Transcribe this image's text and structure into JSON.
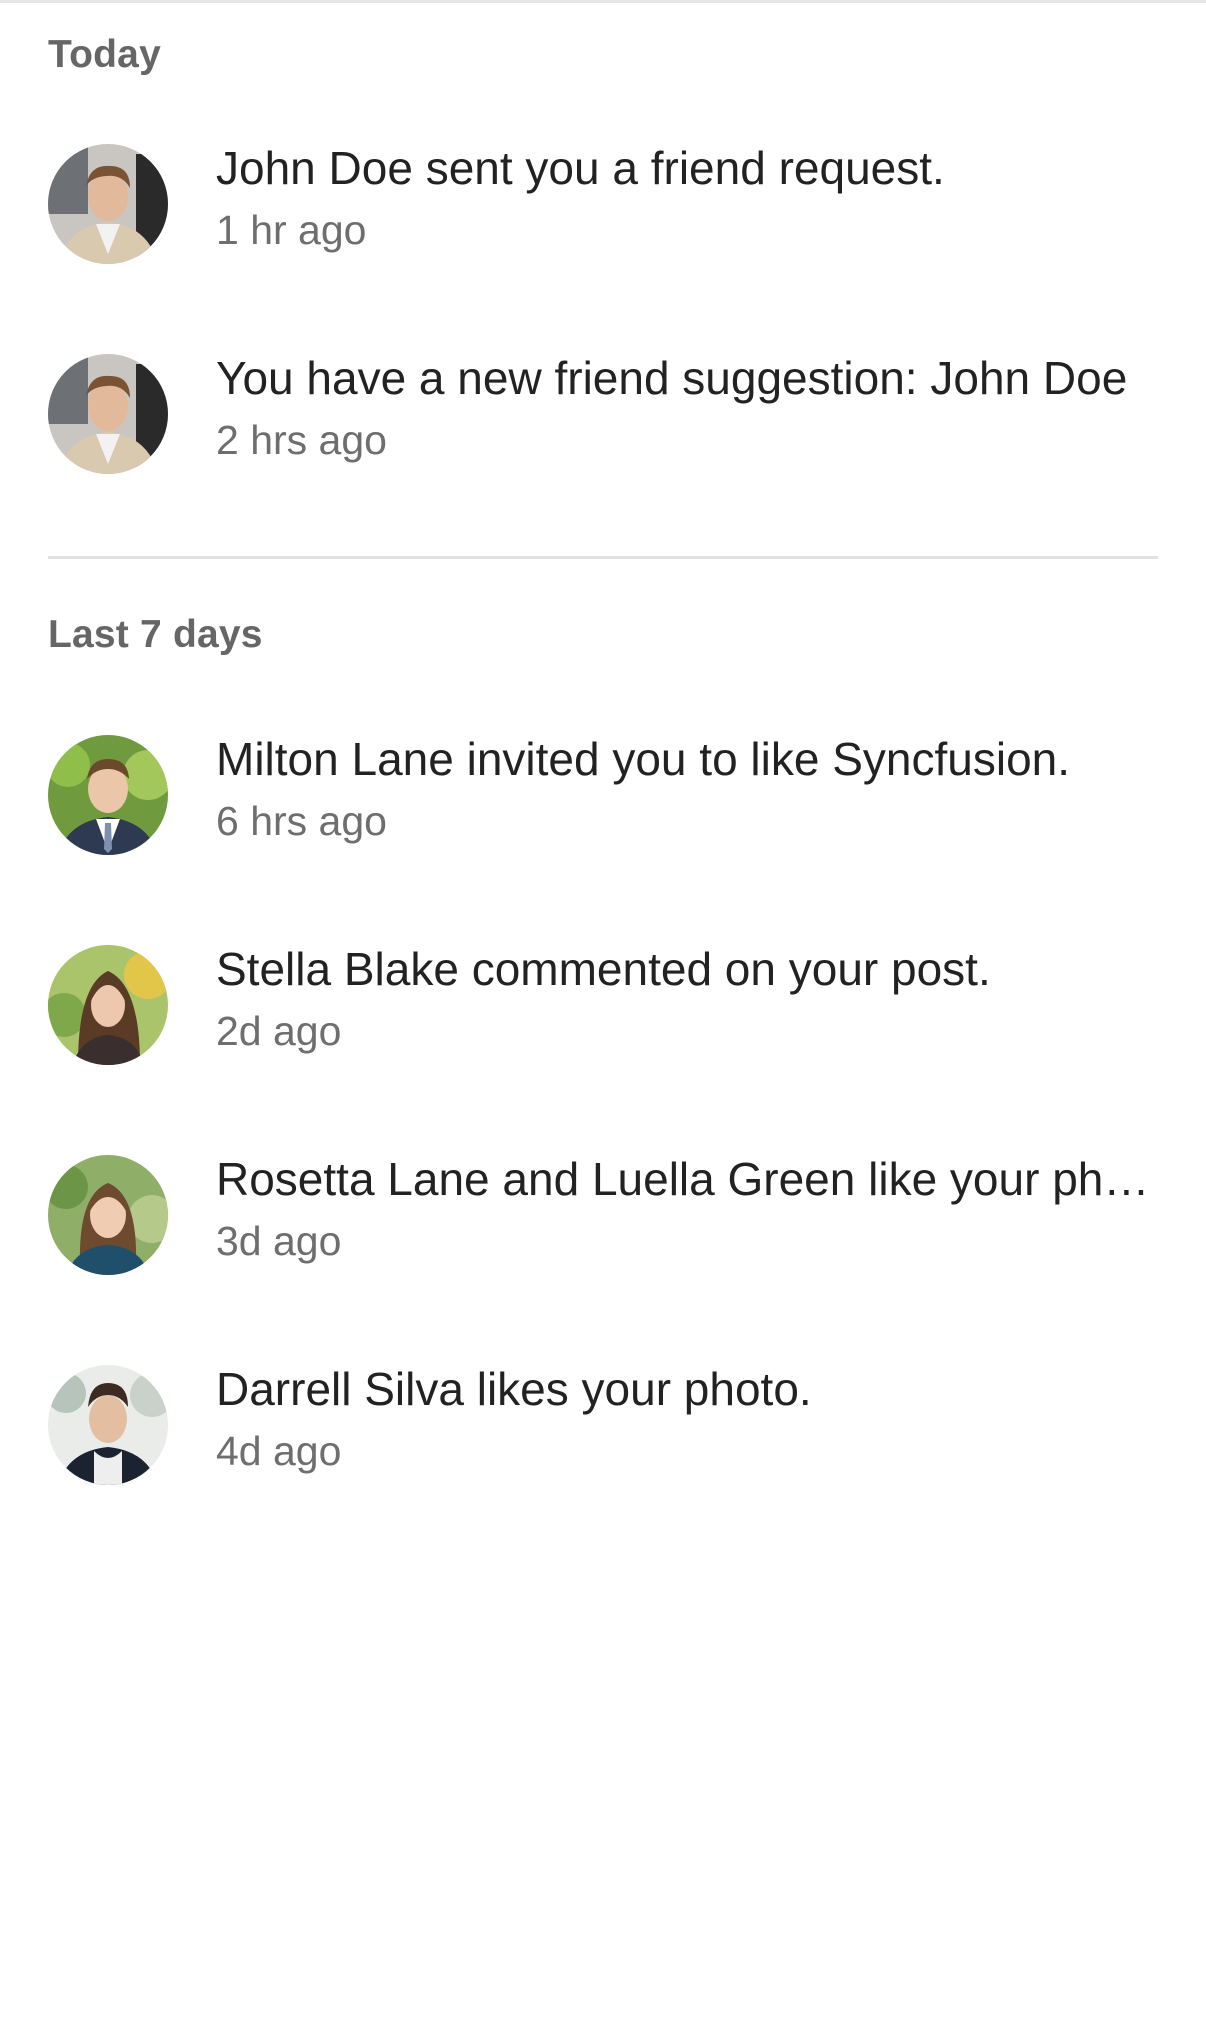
{
  "sections": [
    {
      "header": "Today",
      "items": [
        {
          "text": "John Doe sent you a friend request.",
          "time": "1 hr ago",
          "avatar": "man-beige-jacket-avatar"
        },
        {
          "text": "You have a new friend suggestion: John Doe",
          "time": "2 hrs ago",
          "avatar": "man-beige-jacket-avatar"
        }
      ]
    },
    {
      "header": "Last 7 days",
      "items": [
        {
          "text": "Milton Lane invited you to like Syncfusion.",
          "time": "6 hrs ago",
          "avatar": "man-suit-tie-avatar"
        },
        {
          "text": "Stella Blake commented on your post.",
          "time": "2d ago",
          "avatar": "woman-long-hair-avatar"
        },
        {
          "text": "Rosetta Lane and Luella Green like your ph…",
          "time": "3d ago",
          "avatar": "woman-smiling-avatar"
        },
        {
          "text": "Darrell Silva likes your photo.",
          "time": "4d ago",
          "avatar": "man-dark-jacket-avatar"
        }
      ]
    }
  ],
  "colors": {
    "header": "#666666",
    "title": "#222222",
    "time": "#6e6e6e",
    "divider": "#e2e2e2"
  }
}
